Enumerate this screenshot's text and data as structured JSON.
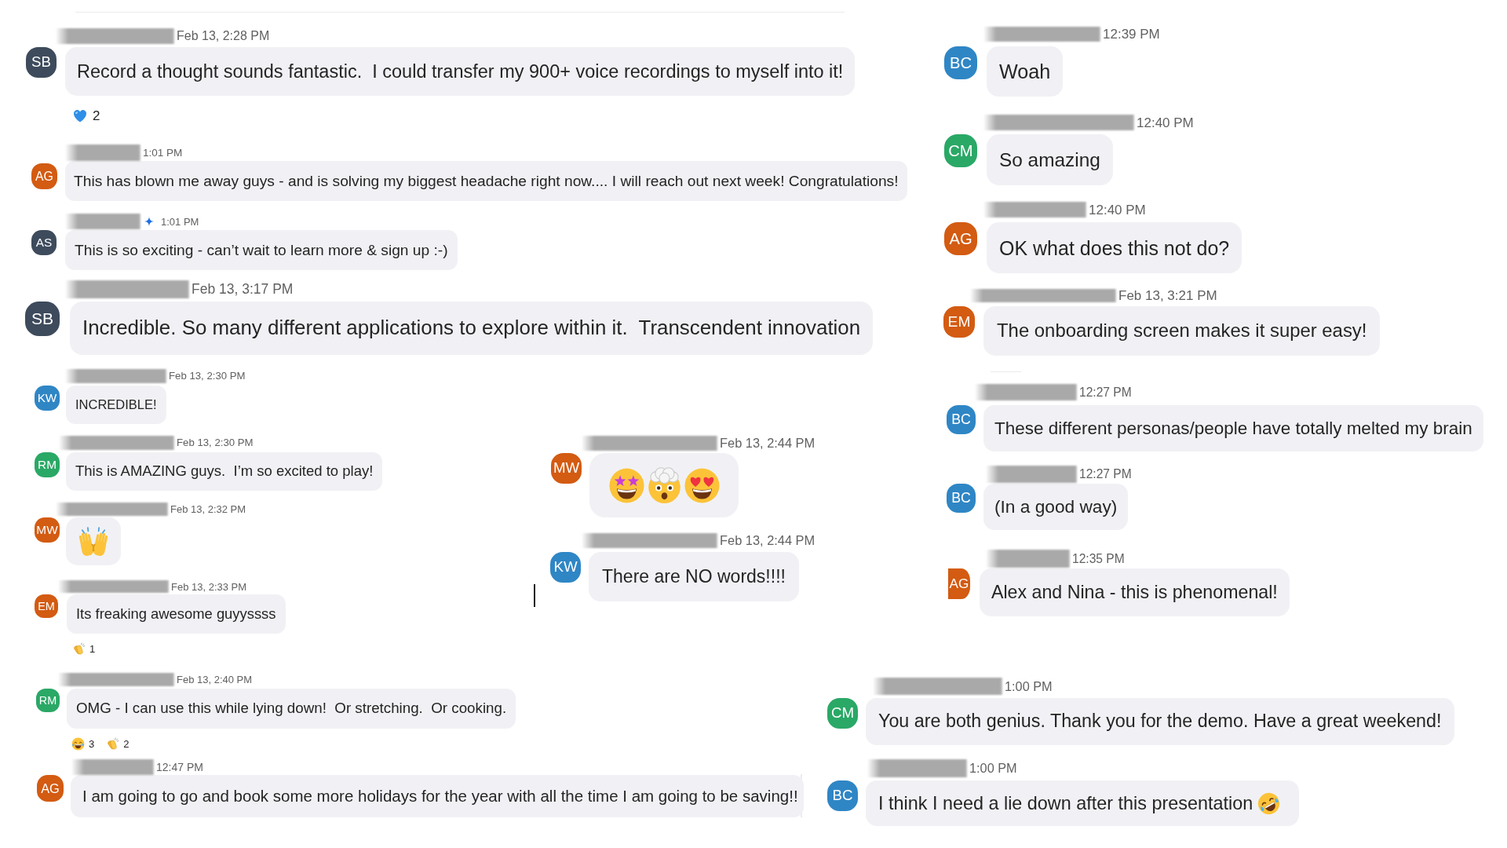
{
  "messages": [
    {
      "initials": "SB",
      "color": "#3d4b5c",
      "badge": false,
      "time": "Feb 13, 2:28 PM",
      "text": "Record a thought sounds fantastic.  I could transfer my 900+ voice recordings to myself into it!",
      "reactions": [
        {
          "kind": "heart",
          "count": "2"
        }
      ]
    },
    {
      "initials": "AG",
      "color": "#d35b12",
      "badge": false,
      "time": "1:01 PM",
      "text": "This has blown me away guys - and is solving my biggest headache right now.... I will reach out next week! Congratulations!"
    },
    {
      "initials": "AS",
      "color": "#3d4b5c",
      "badge": true,
      "time": "1:01 PM",
      "text": "This is so exciting - can’t wait to learn more & sign up :-)"
    },
    {
      "initials": "SB",
      "color": "#3d4b5c",
      "badge": false,
      "time": "Feb 13, 3:17 PM",
      "text": "Incredible. So many different applications to explore within it.  Transcendent innovation"
    },
    {
      "initials": "KW",
      "color": "#2f86c5",
      "badge": false,
      "time": "Feb 13, 2:30 PM",
      "text": "INCREDIBLE!"
    },
    {
      "initials": "RM",
      "color": "#2aa866",
      "badge": false,
      "time": "Feb 13, 2:30 PM",
      "text": "This is AMAZING guys.  I’m so excited to play!"
    },
    {
      "initials": "MW",
      "color": "#d35b12",
      "badge": false,
      "time": "Feb 13, 2:32 PM",
      "emojis": [
        {
          "kind": "raisedhands"
        }
      ]
    },
    {
      "initials": "MW",
      "color": "#d35b12",
      "badge": false,
      "time": "Feb 13, 2:44 PM",
      "emojis": [
        {
          "kind": "starstruck"
        },
        {
          "kind": "mindblown"
        },
        {
          "kind": "hearteyes"
        }
      ]
    },
    {
      "initials": "KW",
      "color": "#2f86c5",
      "badge": false,
      "time": "Feb 13, 2:44 PM",
      "text": "There are NO words!!!!"
    },
    {
      "initials": "EM",
      "color": "#d35b12",
      "badge": false,
      "time": "Feb 13, 2:33 PM",
      "text": "Its freaking awesome guyyssss",
      "reactions": [
        {
          "kind": "clap",
          "count": "1"
        }
      ]
    },
    {
      "initials": "RM",
      "color": "#2aa866",
      "badge": false,
      "time": "Feb 13, 2:40 PM",
      "text": "OMG - I can use this while lying down!  Or stretching.  Or cooking.",
      "reactions": [
        {
          "kind": "laugh",
          "count": "3"
        },
        {
          "kind": "clap",
          "count": "2"
        }
      ]
    },
    {
      "initials": "AG",
      "color": "#d35b12",
      "badge": false,
      "time": "12:47 PM",
      "text": "I am going to go and book some more holidays for the year with all the time I am going to be saving!!"
    },
    {
      "initials": "BC",
      "color": "#2f86c5",
      "badge": false,
      "time": "12:39 PM",
      "text": "Woah"
    },
    {
      "initials": "CM",
      "color": "#2aa866",
      "badge": false,
      "time": "12:40 PM",
      "text": "So amazing"
    },
    {
      "initials": "AG",
      "color": "#d35b12",
      "badge": false,
      "time": "12:40 PM",
      "text": "OK what does this not do?"
    },
    {
      "initials": "EM",
      "color": "#d35b12",
      "badge": false,
      "time": "Feb 13, 3:21 PM",
      "text": "The onboarding screen makes it super easy!"
    },
    {
      "initials": "BC",
      "color": "#2f86c5",
      "badge": false,
      "time": "12:27 PM",
      "text": "These different personas/people have totally melted my brain"
    },
    {
      "initials": "BC",
      "color": "#2f86c5",
      "badge": false,
      "time": "12:27 PM",
      "text": "(In a good way)"
    },
    {
      "initials": "AG",
      "color": "#d35b12",
      "badge": false,
      "time": "12:35 PM",
      "text": "Alex and Nina - this is phenomenal!"
    },
    {
      "initials": "CM",
      "color": "#2aa866",
      "badge": false,
      "time": "1:00 PM",
      "text": "You are both genius. Thank you for the demo. Have a great weekend!"
    },
    {
      "initials": "BC",
      "color": "#2f86c5",
      "badge": false,
      "time": "1:00 PM",
      "text": "I think I need a lie down after this presentation",
      "emojis": [
        {
          "kind": "rofl"
        }
      ]
    }
  ]
}
